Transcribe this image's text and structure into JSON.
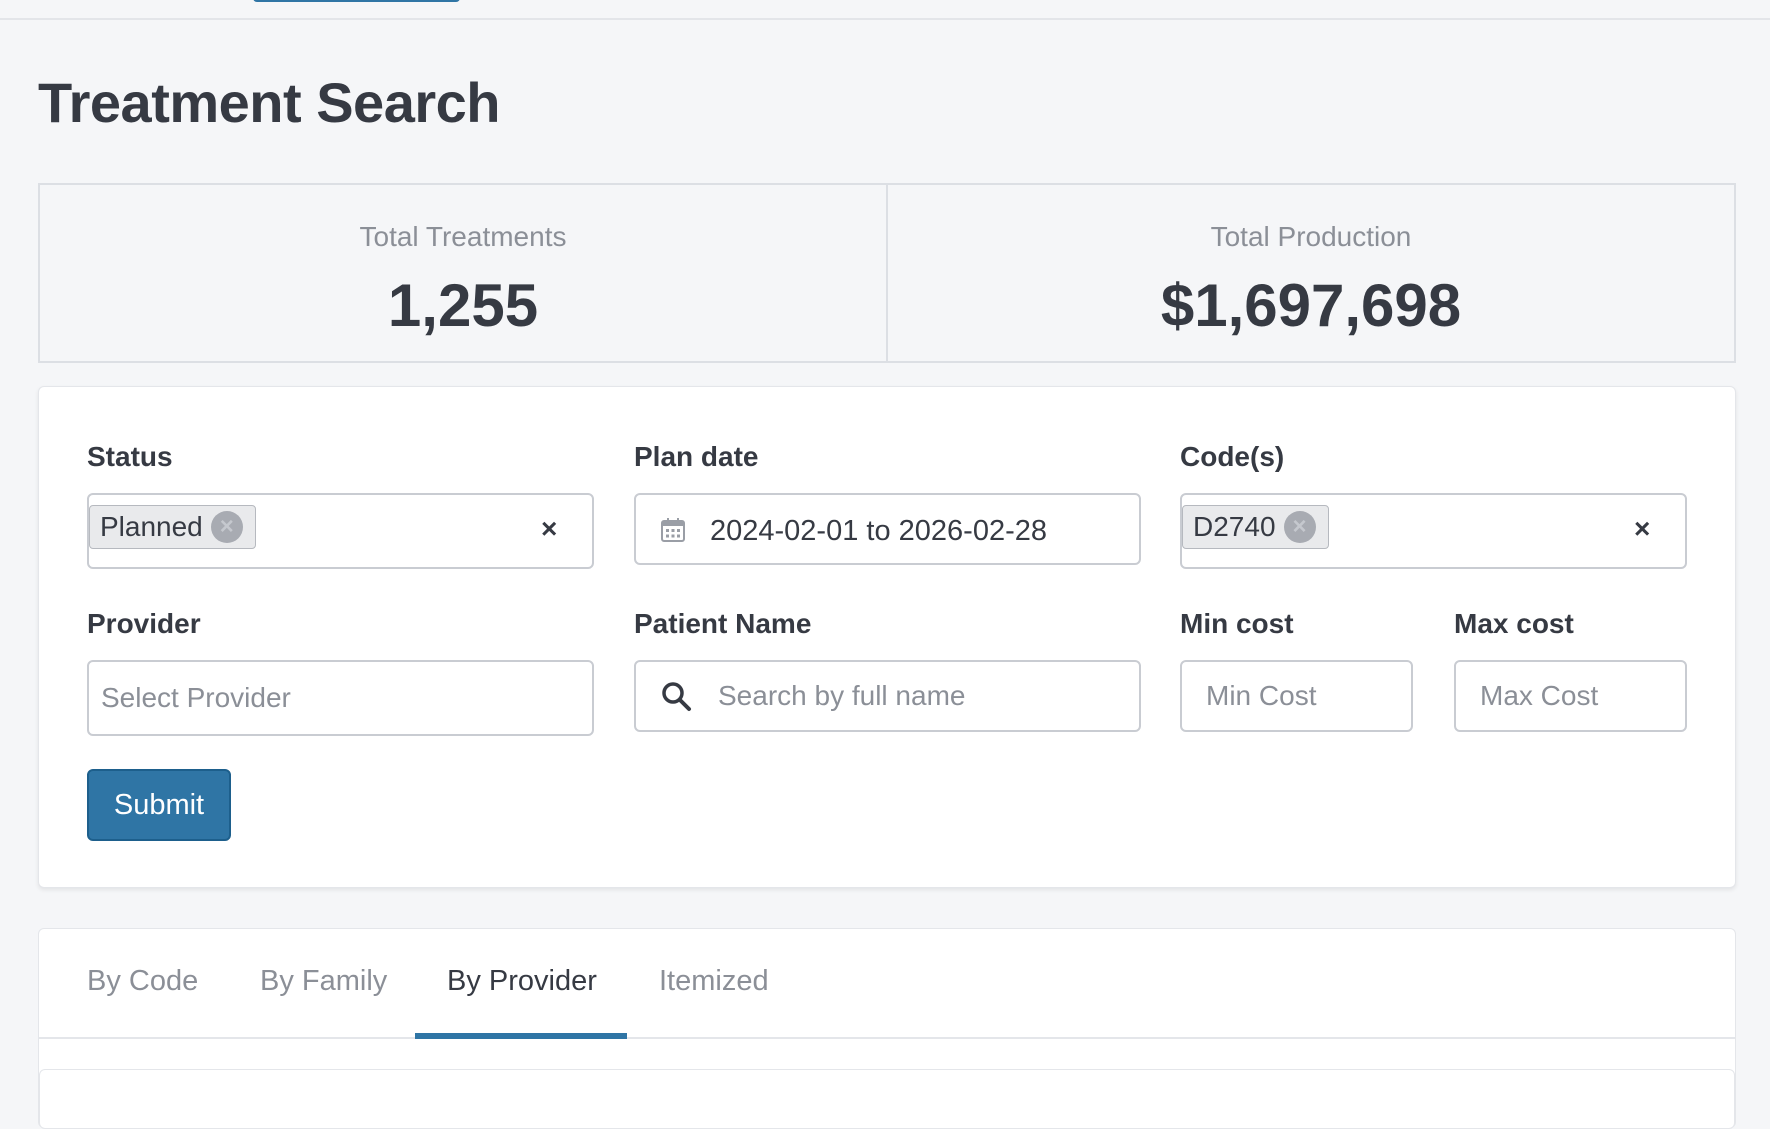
{
  "page": {
    "title": "Treatment Search"
  },
  "stats": [
    {
      "label": "Total Treatments",
      "value": "1,255"
    },
    {
      "label": "Total Production",
      "value": "$1,697,698"
    }
  ],
  "filters": {
    "status": {
      "label": "Status",
      "tag": "Planned",
      "clear": "×"
    },
    "plan_date": {
      "label": "Plan date",
      "value": "2024-02-01 to 2026-02-28"
    },
    "codes": {
      "label": "Code(s)",
      "tag": "D2740",
      "clear": "×"
    },
    "provider": {
      "label": "Provider",
      "placeholder": "Select Provider"
    },
    "patient_name": {
      "label": "Patient Name",
      "placeholder": "Search by full name"
    },
    "min_cost": {
      "label": "Min cost",
      "placeholder": "Min Cost"
    },
    "max_cost": {
      "label": "Max cost",
      "placeholder": "Max Cost"
    },
    "submit_label": "Submit"
  },
  "tabs": [
    {
      "label": "By Code",
      "active": false
    },
    {
      "label": "By Family",
      "active": false
    },
    {
      "label": "By Provider",
      "active": true
    },
    {
      "label": "Itemized",
      "active": false
    }
  ],
  "colors": {
    "accent": "#2f75a5",
    "text": "#363a43",
    "muted": "#8b8f97",
    "background": "#f5f6f8"
  },
  "icons": {
    "date": "calendar-icon",
    "search": "search-icon",
    "tag_remove": "circle-x-icon",
    "clear": "close-icon"
  }
}
